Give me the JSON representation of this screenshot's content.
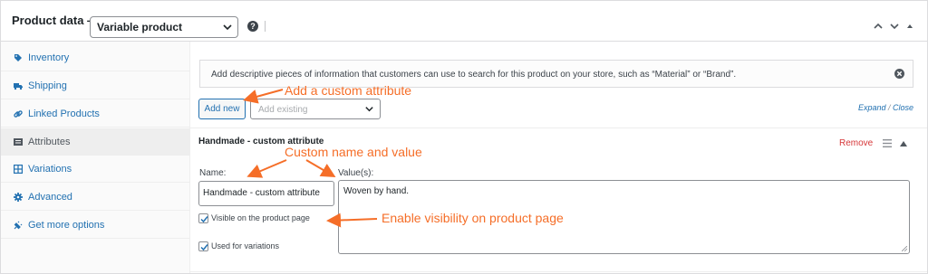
{
  "header": {
    "title": "Product data —",
    "product_type": "Variable product",
    "help_icon": "question-icon",
    "controls": [
      "chevron-up-icon",
      "chevron-down-icon",
      "triangle-up-icon"
    ]
  },
  "sidebar": {
    "items": [
      {
        "label": "Inventory",
        "icon": "tag-icon"
      },
      {
        "label": "Shipping",
        "icon": "truck-icon"
      },
      {
        "label": "Linked Products",
        "icon": "link-icon"
      },
      {
        "label": "Attributes",
        "icon": "list-icon",
        "active": true
      },
      {
        "label": "Variations",
        "icon": "grid-icon"
      },
      {
        "label": "Advanced",
        "icon": "gear-icon"
      },
      {
        "label": "Get more options",
        "icon": "plugin-icon"
      }
    ]
  },
  "main": {
    "notice": "Add descriptive pieces of information that customers can use to search for this product on your store, such as “Material” or “Brand”.",
    "add_new_label": "Add new",
    "add_existing_placeholder": "Add existing",
    "expand_label": "Expand",
    "close_label": "Close",
    "attribute": {
      "title": "Handmade - custom attribute",
      "remove_label": "Remove",
      "name_label": "Name:",
      "name_value": "Handmade - custom attribute",
      "values_label": "Value(s):",
      "values_value": "Woven by hand.",
      "visible_label": "Visible on the product page",
      "visible_checked": true,
      "variations_label": "Used for variations",
      "variations_checked": true
    }
  },
  "annotations": {
    "add_custom": "Add a custom attribute",
    "custom_name": "Custom name and value",
    "enable_visibility": "Enable visibility on product page",
    "color": "#f56e28"
  }
}
